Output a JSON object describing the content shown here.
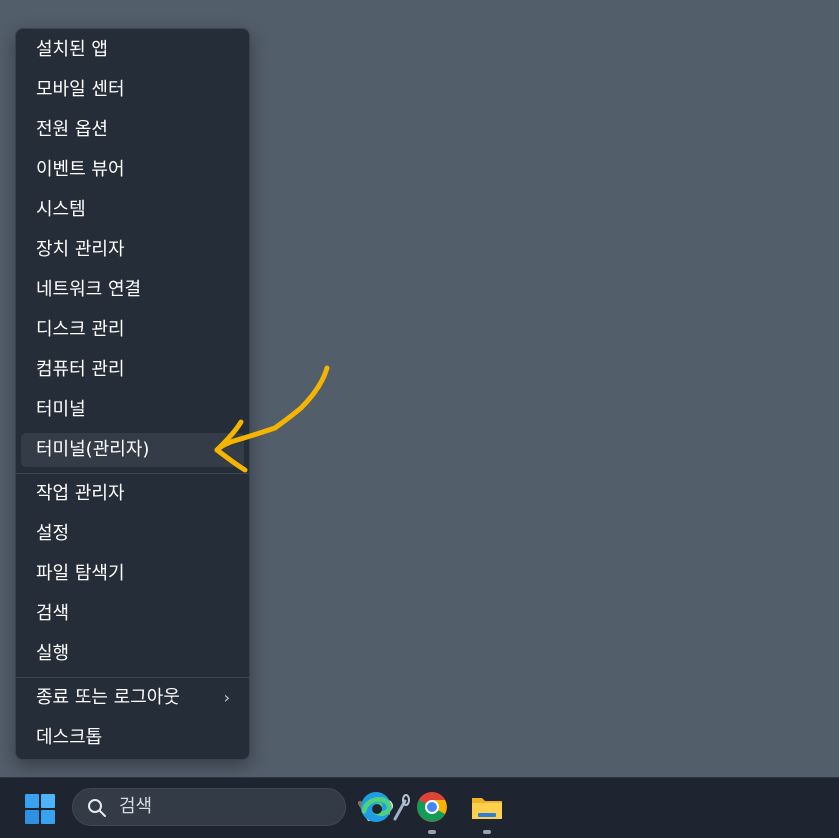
{
  "context_menu": {
    "items": [
      {
        "label": "설치된 앱"
      },
      {
        "label": "모바일 센터"
      },
      {
        "label": "전원 옵션"
      },
      {
        "label": "이벤트 뷰어"
      },
      {
        "label": "시스템"
      },
      {
        "label": "장치 관리자"
      },
      {
        "label": "네트워크 연결"
      },
      {
        "label": "디스크 관리"
      },
      {
        "label": "컴퓨터 관리"
      },
      {
        "label": "터미널"
      },
      {
        "label": "터미널(관리자)"
      },
      {
        "label": "작업 관리자"
      },
      {
        "label": "설정"
      },
      {
        "label": "파일 탐색기"
      },
      {
        "label": "검색"
      },
      {
        "label": "실행"
      },
      {
        "label": "종료 또는 로그아웃"
      },
      {
        "label": "데스크톱"
      }
    ],
    "highlighted_item": "터미널(관리자)"
  },
  "annotation": {
    "color": "#f5b400",
    "icon": "hand-drawn-arrow-icon"
  },
  "taskbar": {
    "search": {
      "label": "검색",
      "icon": "search-icon"
    },
    "apps": [
      {
        "name": "microsoft-edge",
        "icon": "edge-icon",
        "running": false
      },
      {
        "name": "google-chrome",
        "icon": "chrome-icon",
        "running": true
      },
      {
        "name": "file-explorer",
        "icon": "folder-icon",
        "running": true
      }
    ]
  },
  "colors": {
    "desktop": "#535e6b",
    "menu_background": "#252d38",
    "taskbar": "#1e2530",
    "start_blue": "#3aa0f0"
  }
}
